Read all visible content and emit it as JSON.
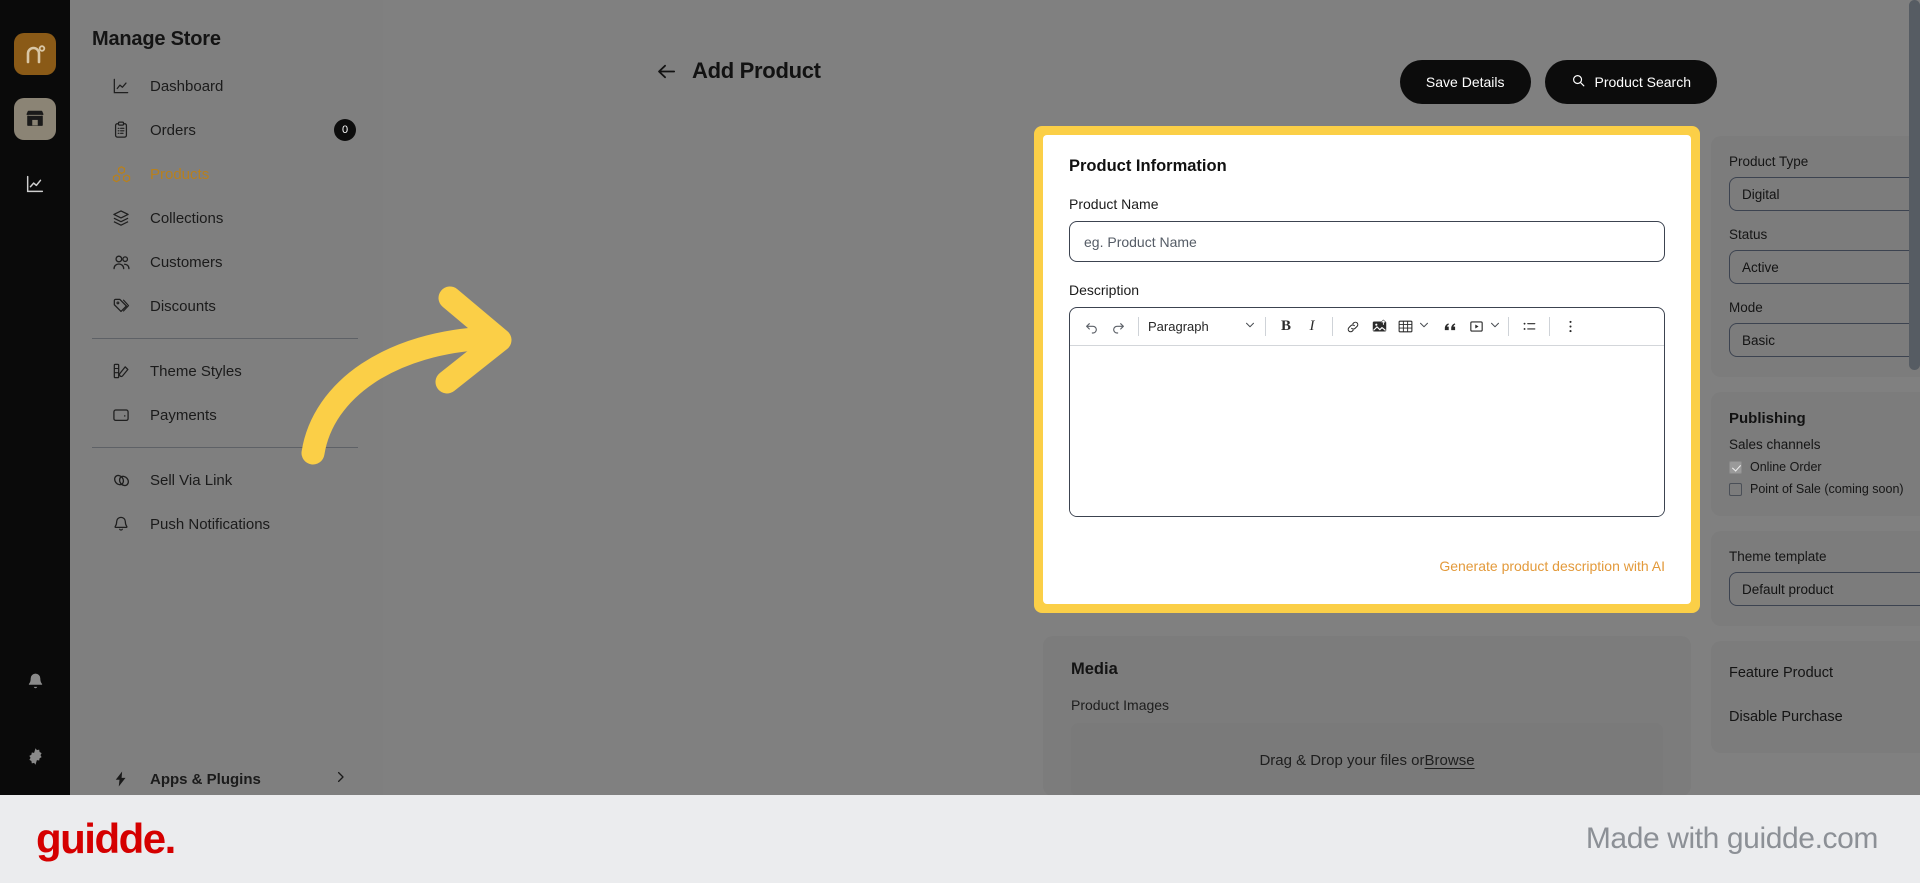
{
  "rail": {
    "logo_icon": "nuvio-logo-icon",
    "items": [
      {
        "icon": "store-icon",
        "name": "store"
      },
      {
        "icon": "analytics-chart-icon",
        "name": "analytics"
      }
    ],
    "bottom": [
      {
        "icon": "bell-icon",
        "name": "notifications"
      },
      {
        "icon": "gear-icon",
        "name": "settings"
      }
    ]
  },
  "sidebar": {
    "title": "Manage Store",
    "items": [
      {
        "label": "Dashboard",
        "icon": "chart-line-icon",
        "badge": null,
        "active": false
      },
      {
        "label": "Orders",
        "icon": "clipboard-icon",
        "badge": "0",
        "active": false
      },
      {
        "label": "Products",
        "icon": "boxes-icon",
        "badge": null,
        "active": true
      },
      {
        "label": "Collections",
        "icon": "layers-icon",
        "badge": null,
        "active": false
      },
      {
        "label": "Customers",
        "icon": "users-icon",
        "badge": null,
        "active": false
      },
      {
        "label": "Discounts",
        "icon": "tag-icon",
        "badge": null,
        "active": false
      },
      {
        "label": "Theme Styles",
        "icon": "palette-icon",
        "badge": null,
        "active": false
      },
      {
        "label": "Payments",
        "icon": "wallet-icon",
        "badge": null,
        "active": false
      },
      {
        "label": "Sell Via Link",
        "icon": "link-icon",
        "badge": null,
        "active": false
      },
      {
        "label": "Push Notifications",
        "icon": "bell-outline-icon",
        "badge": null,
        "active": false
      }
    ],
    "apps_plugins": "Apps & Plugins"
  },
  "header": {
    "back_icon": "back-arrow-icon",
    "title": "Add Product",
    "save_label": "Save Details",
    "search_label": "Product Search",
    "search_icon": "search-icon"
  },
  "product_information": {
    "title": "Product Information",
    "name_label": "Product Name",
    "name_value": "",
    "name_placeholder": "eg. Product Name",
    "description_label": "Description",
    "ai_link": "Generate product description with AI",
    "toolbar": {
      "undo": "undo-icon",
      "redo": "redo-icon",
      "block_style": "Paragraph",
      "bold": "B",
      "italic": "I",
      "link": "link-icon",
      "image": "image-upload-icon",
      "table": "table-icon",
      "quote": "blockquote-icon",
      "video": "video-icon",
      "bullet_list": "bullet-list-icon",
      "more": "more-vertical-icon"
    },
    "editor_content": ""
  },
  "media": {
    "title": "Media",
    "images_label": "Product Images",
    "dropzone_text": "Drag & Drop your files or ",
    "dropzone_link": "Browse"
  },
  "right_panel": {
    "product_type_label": "Product Type",
    "product_type_value": "Digital",
    "status_label": "Status",
    "status_value": "Active",
    "mode_label": "Mode",
    "mode_value": "Basic",
    "publishing_title": "Publishing",
    "sales_channels_label": "Sales channels",
    "channel_online": "Online Order",
    "channel_pos": "Point of Sale (coming soon)",
    "theme_template_label": "Theme template",
    "theme_template_value": "Default product",
    "feature_product_label": "Feature Product",
    "disable_purchase_label": "Disable Purchase"
  },
  "footer": {
    "logo_text": "guidde.",
    "made_with": "Made with guidde.com"
  },
  "colors": {
    "highlight": "#FBCF47",
    "arrow": "#FBCF47",
    "accent_orange": "#B8801D",
    "ai_link": "#E39A3B",
    "guidde_red": "#D50000"
  }
}
